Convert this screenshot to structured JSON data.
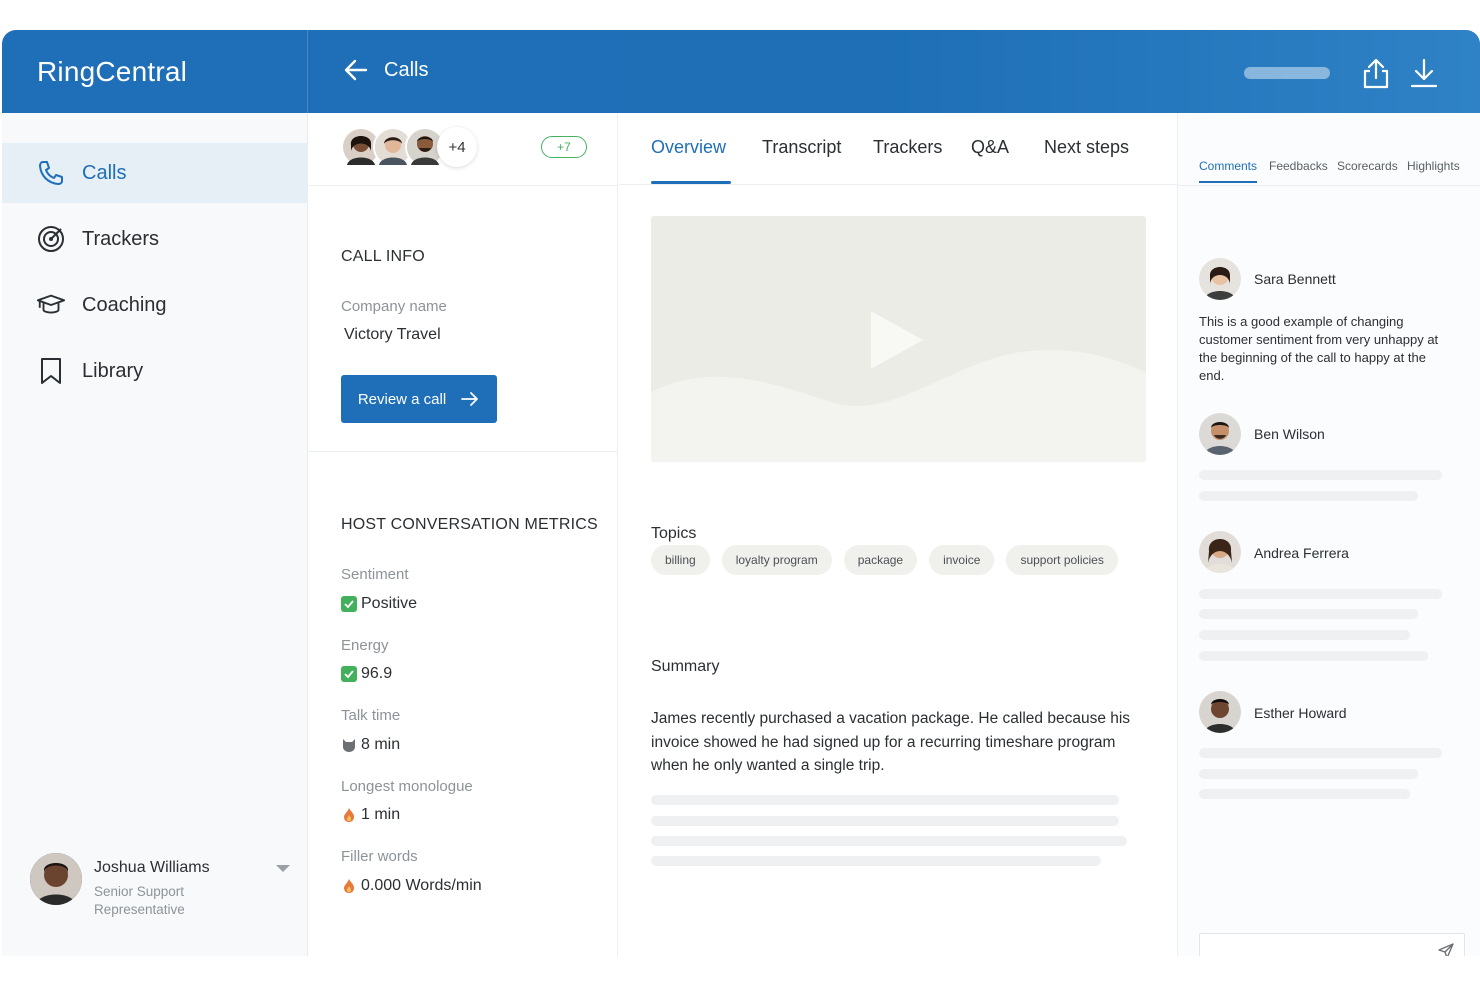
{
  "app": {
    "brand": "RingCentral",
    "page_title": "Calls"
  },
  "sidebar": {
    "items": [
      {
        "label": "Calls",
        "icon": "phone-icon",
        "active": true
      },
      {
        "label": "Trackers",
        "icon": "target-icon",
        "active": false
      },
      {
        "label": "Coaching",
        "icon": "graduation-cap-icon",
        "active": false
      },
      {
        "label": "Library",
        "icon": "bookmark-icon",
        "active": false
      }
    ],
    "user": {
      "name": "Joshua Williams",
      "role": "Senior Support Representative"
    }
  },
  "participants": {
    "extra_count": "+4",
    "badge": "+7"
  },
  "call_info": {
    "title": "CALL INFO",
    "company_label": "Company name",
    "company_value": "Victory Travel",
    "review_button": "Review a call"
  },
  "metrics": {
    "title": "HOST CONVERSATION METRICS",
    "items": [
      {
        "label": "Sentiment",
        "value": "Positive",
        "icon": "check-icon"
      },
      {
        "label": "Energy",
        "value": "96.9",
        "icon": "check-icon"
      },
      {
        "label": "Talk time",
        "value": "8 min",
        "icon": "cat-icon"
      },
      {
        "label": "Longest monologue",
        "value": "1 min",
        "icon": "fire-icon"
      },
      {
        "label": "Filler words",
        "value": "0.000 Words/min",
        "icon": "fire-icon"
      }
    ]
  },
  "tabs": [
    "Overview",
    "Transcript",
    "Trackers",
    "Q&A",
    "Next steps"
  ],
  "topics": {
    "title": "Topics",
    "items": [
      "billing",
      "loyalty program",
      "package",
      "invoice",
      "support policies"
    ]
  },
  "summary": {
    "title": "Summary",
    "text": "James recently purchased a vacation package. He called because his invoice showed he had signed up for a recurring timeshare program when he only wanted a single trip."
  },
  "right_panel": {
    "tabs": [
      "Comments",
      "Feedbacks",
      "Scorecards",
      "Highlights"
    ],
    "comments": [
      {
        "author": "Sara Bennett",
        "text": "This is a good example of changing customer sentiment from very unhappy at the beginning of the call to happy at the end."
      },
      {
        "author": "Ben Wilson",
        "text": ""
      },
      {
        "author": "Andrea Ferrera",
        "text": ""
      },
      {
        "author": "Esther Howard",
        "text": ""
      }
    ]
  },
  "colors": {
    "brand_blue": "#1f6fb8",
    "positive_green": "#43b05c",
    "badge_green": "#46b063"
  }
}
